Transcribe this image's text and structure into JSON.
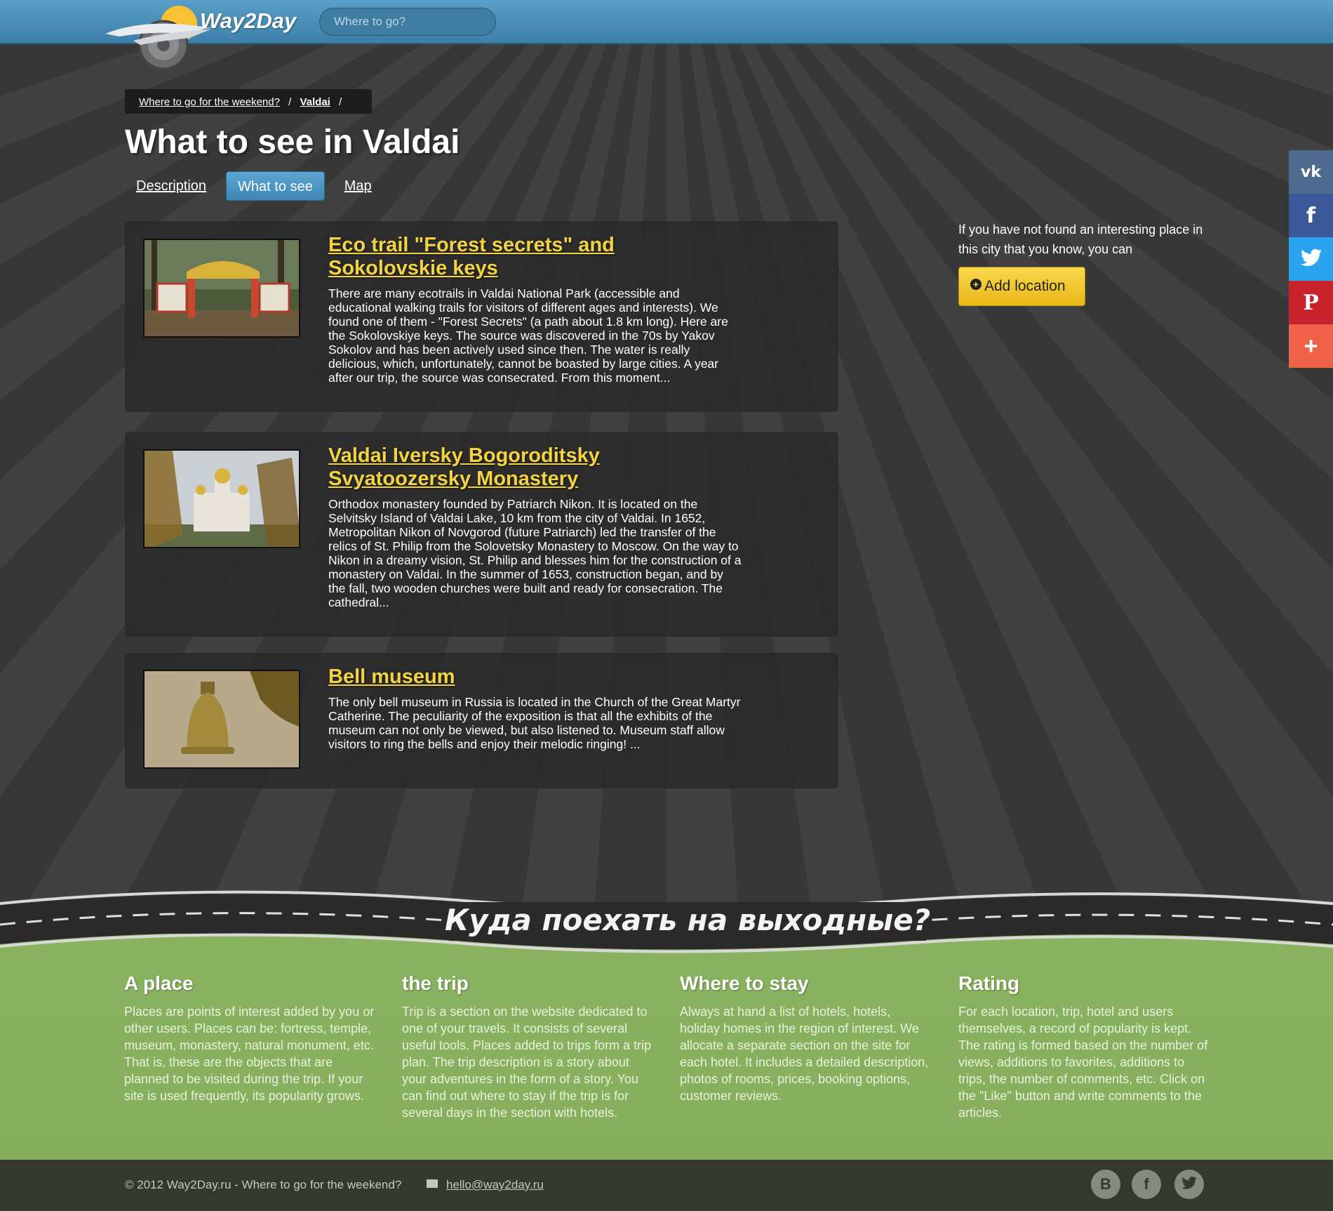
{
  "header": {
    "logo_text": "Way2Day",
    "search_placeholder": "Where to go?"
  },
  "breadcrumb": {
    "parent": "Where to go for the weekend?",
    "current": "Valdai",
    "sep": "/"
  },
  "page_title": "What to see in Valdai",
  "tabs": [
    {
      "label": "Description",
      "active": false
    },
    {
      "label": "What to see",
      "active": true
    },
    {
      "label": "Map",
      "active": false
    }
  ],
  "places": [
    {
      "title": "Eco trail \"Forest secrets\" and Sokolovskie keys",
      "text": "There are many ecotrails in Valdai National Park (accessible and educational walking trails for visitors of different ages and interests). We found one of them - \"Forest Secrets\" (a path about 1.8 km long). Here are the Sokolovskiye keys. The source was discovered in the 70s by Yakov Sokolov and has been actively used since then. The water is really delicious, which, unfortunately, cannot be boasted by large cities. A year after our trip, the source was consecrated. From this moment..."
    },
    {
      "title": "Valdai Iversky Bogoroditsky Svyatoozersky Monastery",
      "text": "Orthodox monastery founded by Patriarch Nikon. It is located on the Selvitsky Island of Valdai Lake, 10 km from the city of Valdai. In 1652, Metropolitan Nikon of Novgorod (future Patriarch) led the transfer of the relics of St. Philip from the Solovetsky Monastery to Moscow. On the way to Nikon in a dreamy vision, St. Philip and blesses him for the construction of a monastery on Valdai. In the summer of 1653, construction began, and by the fall, two wooden churches were built and ready for consecration. The cathedral..."
    },
    {
      "title": "Bell museum",
      "text": "The only bell museum in Russia is located in the Church of the Great Martyr Catherine. The peculiarity of the exposition is that all the exhibits of the museum can not only be viewed, but also listened to. Museum staff allow visitors to ring the bells and enjoy their melodic ringing! ..."
    }
  ],
  "sidebar": {
    "text": "If you have not found an interesting place in this city that you know, you can",
    "add_button": "Add location"
  },
  "share": [
    {
      "icon": "vk-icon",
      "color": "#4e6b8f",
      "glyph": "vk"
    },
    {
      "icon": "facebook-icon",
      "color": "#3b5998",
      "glyph": "f"
    },
    {
      "icon": "twitter-icon",
      "color": "#2aa3ef",
      "glyph": "t"
    },
    {
      "icon": "pinterest-icon",
      "color": "#c8232c",
      "glyph": "P"
    },
    {
      "icon": "more-icon",
      "color": "#f0624a",
      "glyph": "+"
    }
  ],
  "road_slogan": "Куда поехать на выходные?",
  "footer_cols": [
    {
      "title": "A place",
      "text": "Places are points of interest added by you or other users. Places can be: fortress, temple, museum, monastery, natural monument, etc. That is, these are the objects that are planned to be visited during the trip. If your site is used frequently, its popularity grows."
    },
    {
      "title": "the trip",
      "text": "Trip is a section on the website dedicated to one of your travels. It consists of several useful tools. Places added to trips form a trip plan. The trip description is a story about your adventures in the form of a story. You can find out where to stay if the trip is for several days in the section with hotels."
    },
    {
      "title": "Where to stay",
      "text": "Always at hand a list of hotels, hotels, holiday homes in the region of interest. We allocate a separate section on the site for each hotel. It includes a detailed description, photos of rooms, prices, booking options, customer reviews."
    },
    {
      "title": "Rating",
      "text": "For each location, trip, hotel and users themselves, a record of popularity is kept. The rating is formed based on the number of views, additions to favorites, additions to trips, the number of comments, etc. Click on the \"Like\" button and write comments to the articles."
    }
  ],
  "bottom": {
    "copyright": "© 2012 Way2Day.ru - Where to go for the weekend?",
    "email": "hello@way2day.ru"
  }
}
